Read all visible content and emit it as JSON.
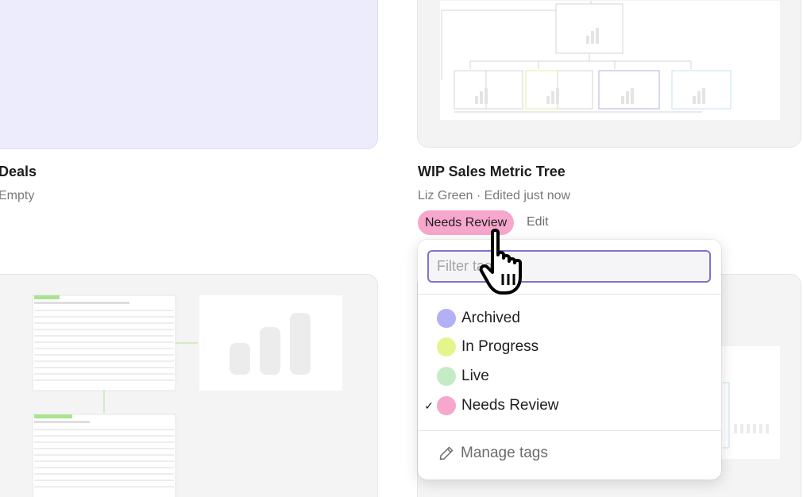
{
  "cards": {
    "deals": {
      "title": "Deals",
      "subtitle": "Empty"
    },
    "metric_tree": {
      "title": "WIP Sales Metric Tree",
      "subtitle": "Liz Green · Edited just now",
      "tag": "Needs Review",
      "edit_label": "Edit"
    }
  },
  "tag_dropdown": {
    "filter_placeholder": "Filter tags",
    "options": [
      {
        "label": "Archived",
        "color": "#b3b0f5",
        "selected": false
      },
      {
        "label": "In Progress",
        "color": "#e5f58e",
        "selected": false
      },
      {
        "label": "Live",
        "color": "#c4ecc4",
        "selected": false
      },
      {
        "label": "Needs Review",
        "color": "#f7a6cc",
        "selected": true
      }
    ],
    "check_mark": "✓",
    "manage_label": "Manage tags"
  }
}
